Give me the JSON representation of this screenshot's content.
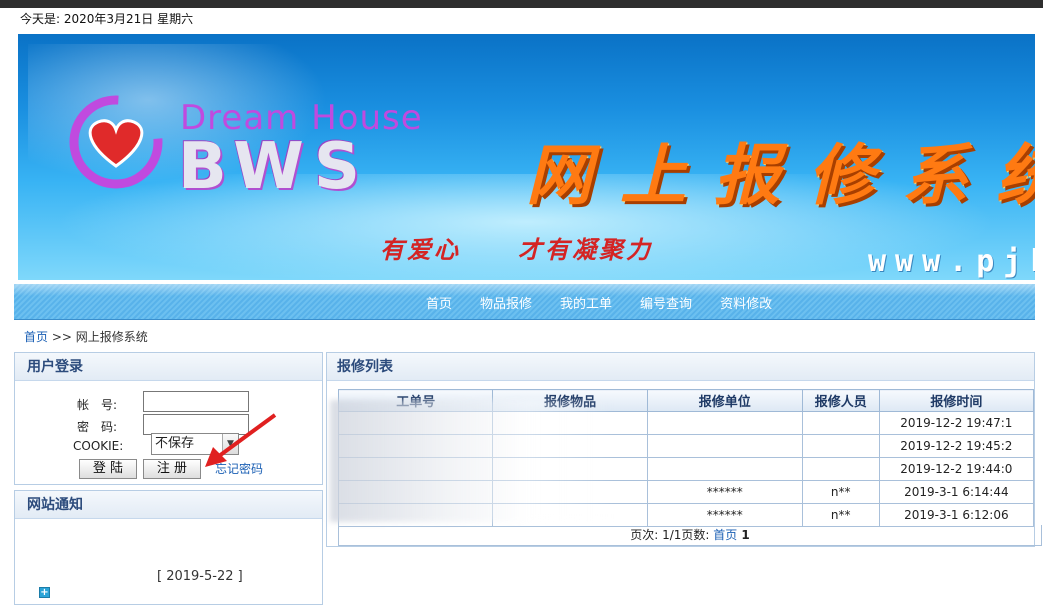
{
  "date_line": "今天是: 2020年3月21日 星期六",
  "banner": {
    "brand_top": "Dream House",
    "brand_big": "BWS",
    "title": "网上报修系统",
    "slogan_1": "有爱心",
    "slogan_2": "才有凝聚力",
    "url": "www.pjh"
  },
  "nav": {
    "items": [
      "首页",
      "物品报修",
      "我的工单",
      "编号查询",
      "资料修改"
    ]
  },
  "breadcrumb": {
    "home": "首页",
    "sep": " >> ",
    "current": "网上报修系统"
  },
  "login": {
    "title": "用户登录",
    "account_label": "帐　号:",
    "password_label": "密　码:",
    "cookie_label": "COOKIE:",
    "cookie_value": "不保存",
    "login_button": "登 陆",
    "register_button": "注 册",
    "forgot_link": "忘记密码"
  },
  "notice": {
    "title": "网站通知",
    "date": "[ 2019-5-22 ]"
  },
  "repair_list": {
    "title": "报修列表",
    "columns": [
      "工单号",
      "报修物品",
      "报修单位",
      "报修人员",
      "报修时间"
    ],
    "rows": [
      [
        "",
        "",
        "",
        "",
        "2019-12-2 19:47:1"
      ],
      [
        "",
        "",
        "",
        "",
        "2019-12-2 19:45:2"
      ],
      [
        "",
        "",
        "",
        "",
        "2019-12-2 19:44:0"
      ],
      [
        "",
        "",
        "******",
        "n**",
        "2019-3-1 6:14:44"
      ],
      [
        "",
        "",
        "******",
        "n**",
        "2019-3-1 6:12:06"
      ]
    ],
    "pager": {
      "label": "页次: ",
      "pages": "1/1页数: ",
      "first": "首页",
      "current": " 1"
    }
  }
}
